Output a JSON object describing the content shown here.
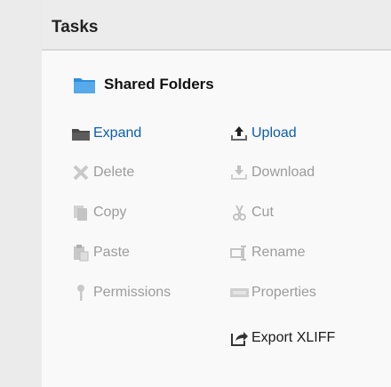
{
  "panel": {
    "title": "Tasks"
  },
  "folder": {
    "label": "Shared Folders",
    "icon": "folder-icon"
  },
  "colors": {
    "link": "#0b5db3",
    "disabled": "#9c9c9c",
    "folder_blue": "#2f8fd8"
  },
  "actions": {
    "expand": {
      "label": "Expand",
      "icon": "folder-dark-icon",
      "state": "enabled"
    },
    "upload": {
      "label": "Upload",
      "icon": "upload-icon",
      "state": "enabled"
    },
    "delete": {
      "label": "Delete",
      "icon": "delete-icon",
      "state": "disabled"
    },
    "download": {
      "label": "Download",
      "icon": "download-icon",
      "state": "disabled"
    },
    "copy": {
      "label": "Copy",
      "icon": "copy-icon",
      "state": "disabled"
    },
    "cut": {
      "label": "Cut",
      "icon": "scissors-icon",
      "state": "disabled"
    },
    "paste": {
      "label": "Paste",
      "icon": "paste-icon",
      "state": "disabled"
    },
    "rename": {
      "label": "Rename",
      "icon": "rename-icon",
      "state": "disabled"
    },
    "permissions": {
      "label": "Permissions",
      "icon": "key-icon",
      "state": "disabled"
    },
    "properties": {
      "label": "Properties",
      "icon": "properties-icon",
      "state": "disabled"
    },
    "export_xliff": {
      "label": "Export XLIFF",
      "icon": "export-icon",
      "state": "enabled"
    }
  }
}
